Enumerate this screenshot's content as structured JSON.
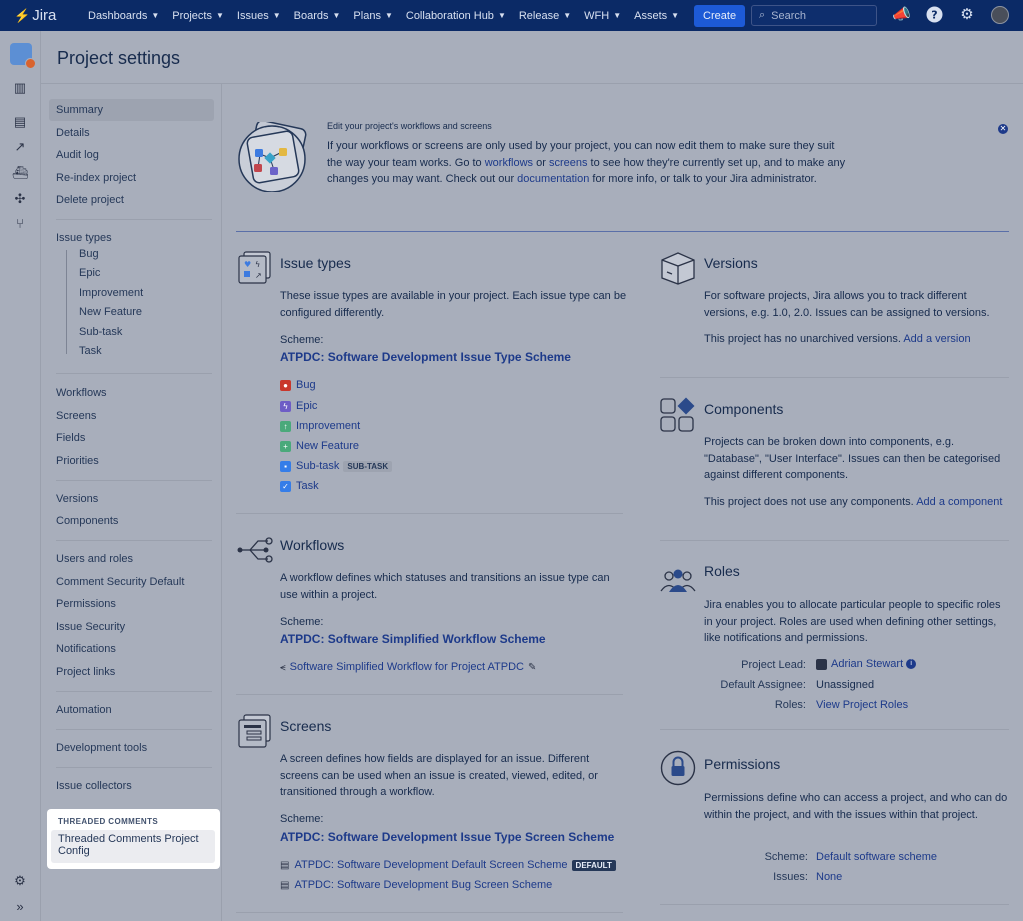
{
  "nav": {
    "logo": "Jira",
    "items": [
      "Dashboards",
      "Projects",
      "Issues",
      "Boards",
      "Plans",
      "Collaboration Hub",
      "Release",
      "WFH",
      "Assets"
    ],
    "create": "Create",
    "search_placeholder": "Search"
  },
  "page": {
    "title": "Project settings"
  },
  "sidebar": {
    "group1": [
      "Summary",
      "Details",
      "Audit log",
      "Re-index project",
      "Delete project"
    ],
    "issue_types": "Issue types",
    "issue_type_children": [
      "Bug",
      "Epic",
      "Improvement",
      "New Feature",
      "Sub-task",
      "Task"
    ],
    "group3": [
      "Workflows",
      "Screens",
      "Fields",
      "Priorities"
    ],
    "group4": [
      "Versions",
      "Components"
    ],
    "group5": [
      "Users and roles",
      "Comment Security Default",
      "Permissions",
      "Issue Security",
      "Notifications",
      "Project links"
    ],
    "automation": "Automation",
    "dev_tools": "Development tools",
    "issue_collectors": "Issue collectors",
    "tc_header": "THREADED COMMENTS",
    "tc_item": "Threaded Comments Project Config"
  },
  "banner": {
    "heading": "Edit your project's workflows and screens",
    "text_1": "If your workflows or screens are only used by your project, you can now edit them to make sure they suit the way your team works. Go to ",
    "link_workflows": "workflows",
    "text_2": " or ",
    "link_screens": "screens",
    "text_3": " to see how they're currently set up, and to make any changes you may want. Check out our ",
    "link_docs": "documentation",
    "text_4": " for more info, or talk to your Jira administrator."
  },
  "issue_types": {
    "title": "Issue types",
    "desc": "These issue types are available in your project. Each issue type can be configured differently.",
    "scheme_label": "Scheme:",
    "scheme": "ATPDC: Software Development Issue Type Scheme",
    "items": [
      "Bug",
      "Epic",
      "Improvement",
      "New Feature",
      "Sub-task",
      "Task"
    ],
    "subtask_badge": "SUB-TASK",
    "colors": {
      "bug": "#c9372c",
      "epic": "#6e5dc6",
      "improvement": "#4aa97b",
      "new_feature": "#4aa97b",
      "subtask": "#357de8",
      "task": "#357de8"
    }
  },
  "workflows": {
    "title": "Workflows",
    "desc": "A workflow defines which statuses and transitions an issue type can use within a project.",
    "scheme_label": "Scheme:",
    "scheme": "ATPDC: Software Simplified Workflow Scheme",
    "workflow": "Software Simplified Workflow for Project ATPDC"
  },
  "screens": {
    "title": "Screens",
    "desc": "A screen defines how fields are displayed for an issue. Different screens can be used when an issue is created, viewed, edited, or transitioned through a workflow.",
    "scheme_label": "Scheme:",
    "scheme": "ATPDC: Software Development Issue Type Screen Scheme",
    "items": [
      "ATPDC: Software Development Default Screen Scheme",
      "ATPDC: Software Development Bug Screen Scheme"
    ],
    "default_badge": "DEFAULT"
  },
  "versions": {
    "title": "Versions",
    "desc": "For software projects, Jira allows you to track different versions, e.g. 1.0, 2.0. Issues can be assigned to versions.",
    "status": "This project has no unarchived versions. ",
    "action": "Add a version"
  },
  "components": {
    "title": "Components",
    "desc": "Projects can be broken down into components, e.g. \"Database\", \"User Interface\". Issues can then be categorised against different components.",
    "status": "This project does not use any components. ",
    "action": "Add a component"
  },
  "roles": {
    "title": "Roles",
    "desc": "Jira enables you to allocate particular people to specific roles in your project. Roles are used when defining other settings, like notifications and permissions.",
    "lead_label": "Project Lead:",
    "lead": "Adrian Stewart",
    "assignee_label": "Default Assignee:",
    "assignee": "Unassigned",
    "roles_label": "Roles:",
    "roles_link": "View Project Roles"
  },
  "permissions": {
    "title": "Permissions",
    "desc": "Permissions define who can access a project, and who can do within the project, and with the issues within that project.",
    "scheme_label": "Scheme:",
    "scheme": "Default software scheme",
    "issues_label": "Issues:",
    "issues": "None"
  }
}
